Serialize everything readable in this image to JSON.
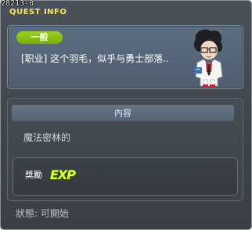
{
  "window": {
    "quest_id": "28213-0",
    "title": "QUEST INFO"
  },
  "quest": {
    "category": "一般",
    "line": "[职业] 这个羽毛，似乎与勇士部落..",
    "npc_icon": "npc-portrait-icon"
  },
  "content": {
    "header": "內容",
    "text": "魔法密林的"
  },
  "reward": {
    "label": "獎勵",
    "exp": "EXP",
    "exp_icon": "exp-icon"
  },
  "status": {
    "text": "狀態: 可開始"
  },
  "colors": {
    "title": "#ffe45c",
    "badge": "#8cc414",
    "panel": "#5b6d80",
    "exp": "#e3ff2e"
  }
}
